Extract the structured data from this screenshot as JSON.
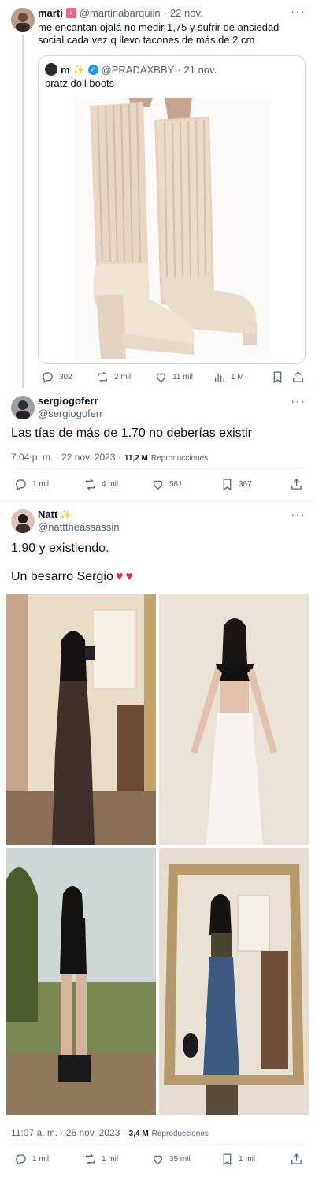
{
  "tweet1": {
    "name": "marti",
    "handle": "@martinabarquiin",
    "date": "22 nov.",
    "text_line1": "me encantan ojalá no medir 1,75 y sufrir de ansiedad",
    "text_line2": "social cada vez q llevo tacones de más de 2 cm",
    "quote": {
      "name": "m",
      "handle": "@PRADAXBBY",
      "date": "21 nov.",
      "text": "bratz doll boots"
    },
    "actions": {
      "replies": "302",
      "retweets": "2 mil",
      "likes": "11 mil",
      "views": "1 M"
    }
  },
  "tweet2": {
    "name": "sergiogoferr",
    "handle": "@sergiogoferr",
    "text": "Las tías de más de 1.70 no deberías existir",
    "time": "7:04 p. m. · 22 nov. 2023 ·",
    "views_count": "11,2 M",
    "views_label": "Reproducciones",
    "actions": {
      "replies": "1 mil",
      "retweets": "4 mil",
      "likes": "581",
      "bookmarks": "367"
    }
  },
  "tweet3": {
    "name": "Natt",
    "handle": "@natttheassassin",
    "text_line1": "1,90 y existiendo.",
    "text_line2": "Un besarro Sergio",
    "time": "11:07 a. m. · 26 nov. 2023 ·",
    "views_count": "3,4 M",
    "views_label": "Reproducciones",
    "actions": {
      "replies": "1 mil",
      "retweets": "1 mil",
      "likes": "35 mil",
      "bookmarks": "1 mil"
    }
  },
  "colors": {
    "accent": "#1d9bf0",
    "muted": "#536471",
    "heart": "#e0245e"
  }
}
